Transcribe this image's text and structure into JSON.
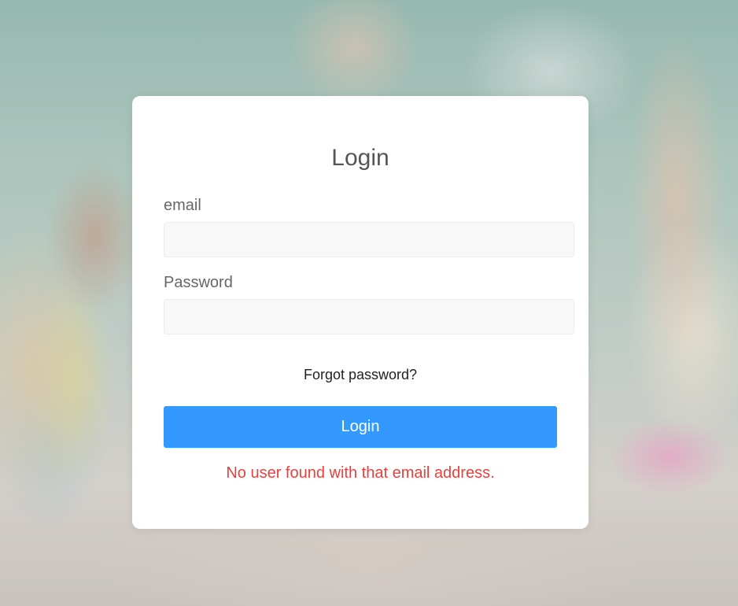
{
  "login": {
    "title": "Login",
    "email_label": "email",
    "email_value": "",
    "email_placeholder": "",
    "password_label": "Password",
    "password_value": "",
    "password_placeholder": "",
    "forgot_link": "Forgot password?",
    "submit_label": "Login",
    "error_message": "No user found with that email address."
  },
  "colors": {
    "button": "#3399ff",
    "error": "#e8403d",
    "input_bg": "#f8f8f8"
  }
}
